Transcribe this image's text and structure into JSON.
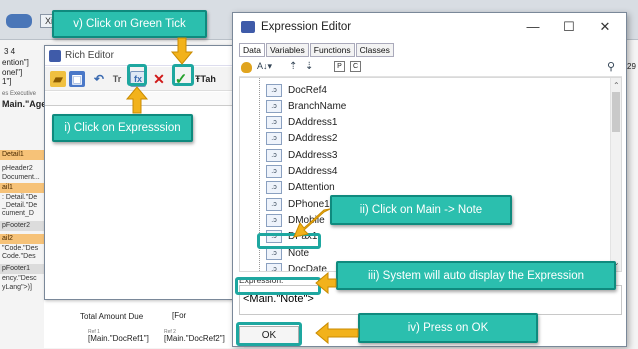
{
  "designer": {
    "bands": [
      {
        "label": "Detail1",
        "kind": "orange"
      },
      {
        "label": "pHeader2",
        "kind": "text"
      },
      {
        "label": "Document...",
        "kind": "text"
      },
      {
        "label": "ail1",
        "kind": "orange"
      },
      {
        "label": ": Detail.\"De",
        "kind": "text"
      },
      {
        "label": "_Detail.\"De",
        "kind": "text"
      },
      {
        "label": "cument_D",
        "kind": "text"
      },
      {
        "label": "pFooter2",
        "kind": "gray"
      },
      {
        "label": "ail2",
        "kind": "orange"
      },
      {
        "label": "\"Code.\"Des",
        "kind": "text"
      },
      {
        "label": "Code.\"Des",
        "kind": "text"
      },
      {
        "label": "pFooter1",
        "kind": "gray"
      },
      {
        "label": "ency.\"Desc",
        "kind": "text"
      },
      {
        "label": "yLang\">)]",
        "kind": "text"
      }
    ],
    "left_texts": [
      "3 4",
      "ention\"]",
      "onel\"]",
      "1\"]",
      "Main.\"Age",
      "es Executive"
    ],
    "total_label": "Total Amount Due",
    "ref1_caption": "Ref 1",
    "ref1": "[Main.\"DocRef1\"]",
    "ref2_caption": "Ref 2",
    "ref2": "[Main.\"DocRef2\"]",
    "form_frag": "[For",
    "right_edge": "29"
  },
  "rich_editor": {
    "title": "Rich Editor",
    "font_btn": "Tah",
    "tb_sample": "Tr"
  },
  "expression_editor": {
    "title": "Expression Editor",
    "tabs": [
      "Data",
      "Variables",
      "Functions",
      "Classes"
    ],
    "tree_items": [
      "DocRef4",
      "BranchName",
      "DAddress1",
      "DAddress2",
      "DAddress3",
      "DAddress4",
      "DAttention",
      "DPhone1",
      "DMobile",
      "DFax1",
      "Note",
      "DocDate"
    ],
    "selected_item": "Note",
    "expression_label": "Expression:",
    "expression_value": "<Main.\"Note\">",
    "ok_label": "OK"
  },
  "callouts": {
    "v": "v) Click on Green Tick",
    "i": "i) Click on Expresssion",
    "ii": "ii) Click on Main -> Note",
    "iii": "iii) System will auto display the Expression",
    "iv": "iv) Press on OK"
  },
  "colors": {
    "callout_bg": "#2bbfae",
    "callout_border": "#0f8a7e",
    "arrow": "#f2b21b",
    "highlight": "#1ea7a0"
  }
}
